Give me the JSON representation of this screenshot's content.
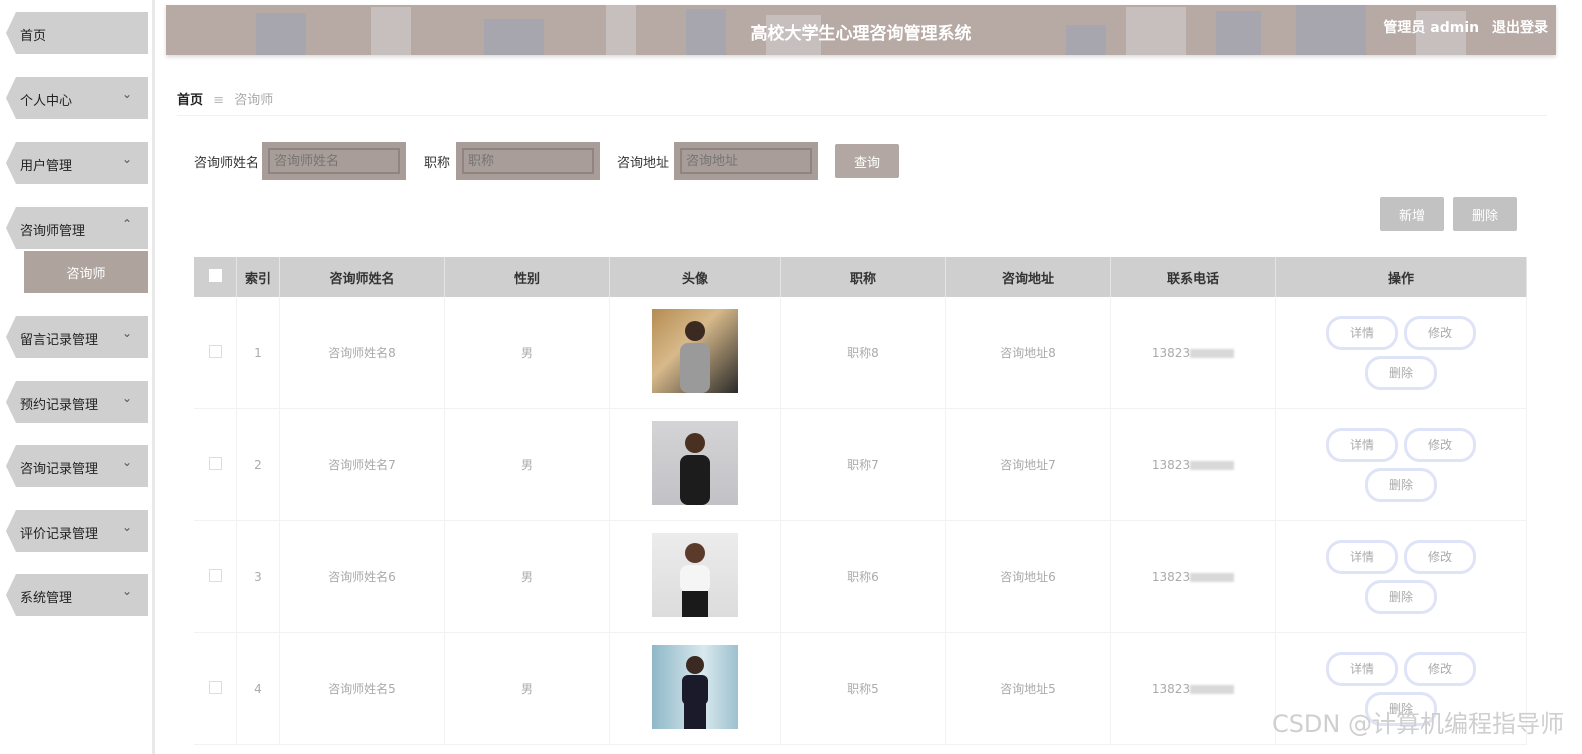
{
  "header": {
    "title": "高校大学生心理咨询管理系统",
    "role_label": "管理员 admin",
    "logout_label": "退出登录",
    "background_color": "#b7a9a4"
  },
  "sidebar": {
    "items": [
      {
        "label": "首页",
        "arrow": ""
      },
      {
        "label": "个人中心",
        "arrow": "⌄"
      },
      {
        "label": "用户管理",
        "arrow": "⌄"
      },
      {
        "label": "咨询师管理",
        "arrow": "⌃"
      },
      {
        "label": "留言记录管理",
        "arrow": "⌄"
      },
      {
        "label": "预约记录管理",
        "arrow": "⌄"
      },
      {
        "label": "咨询记录管理",
        "arrow": "⌄"
      },
      {
        "label": "评价记录管理",
        "arrow": "⌄"
      },
      {
        "label": "系统管理",
        "arrow": "⌄"
      }
    ],
    "active_subitem": "咨询师"
  },
  "breadcrumb": {
    "home": "首页",
    "separator": "≡",
    "current": "咨询师"
  },
  "search": {
    "name_label": "咨询师姓名",
    "name_placeholder": "咨询师姓名",
    "title_label": "职称",
    "title_placeholder": "职称",
    "address_label": "咨询地址",
    "address_placeholder": "咨询地址",
    "query_button": "查询"
  },
  "actions": {
    "add_button": "新增",
    "delete_button": "删除"
  },
  "table": {
    "columns": [
      "",
      "索引",
      "咨询师姓名",
      "性别",
      "头像",
      "职称",
      "咨询地址",
      "联系电话",
      "操作"
    ],
    "rows": [
      {
        "index": "1",
        "name": "咨询师姓名8",
        "gender": "男",
        "title": "职称8",
        "address": "咨询地址8",
        "phone": "13823"
      },
      {
        "index": "2",
        "name": "咨询师姓名7",
        "gender": "男",
        "title": "职称7",
        "address": "咨询地址7",
        "phone": "13823"
      },
      {
        "index": "3",
        "name": "咨询师姓名6",
        "gender": "男",
        "title": "职称6",
        "address": "咨询地址6",
        "phone": "13823"
      },
      {
        "index": "4",
        "name": "咨询师姓名5",
        "gender": "男",
        "title": "职称5",
        "address": "咨询地址5",
        "phone": "13823"
      }
    ],
    "row_actions": {
      "detail": "详情",
      "edit": "修改",
      "delete": "删除"
    }
  },
  "watermark": "CSDN @计算机编程指导师"
}
